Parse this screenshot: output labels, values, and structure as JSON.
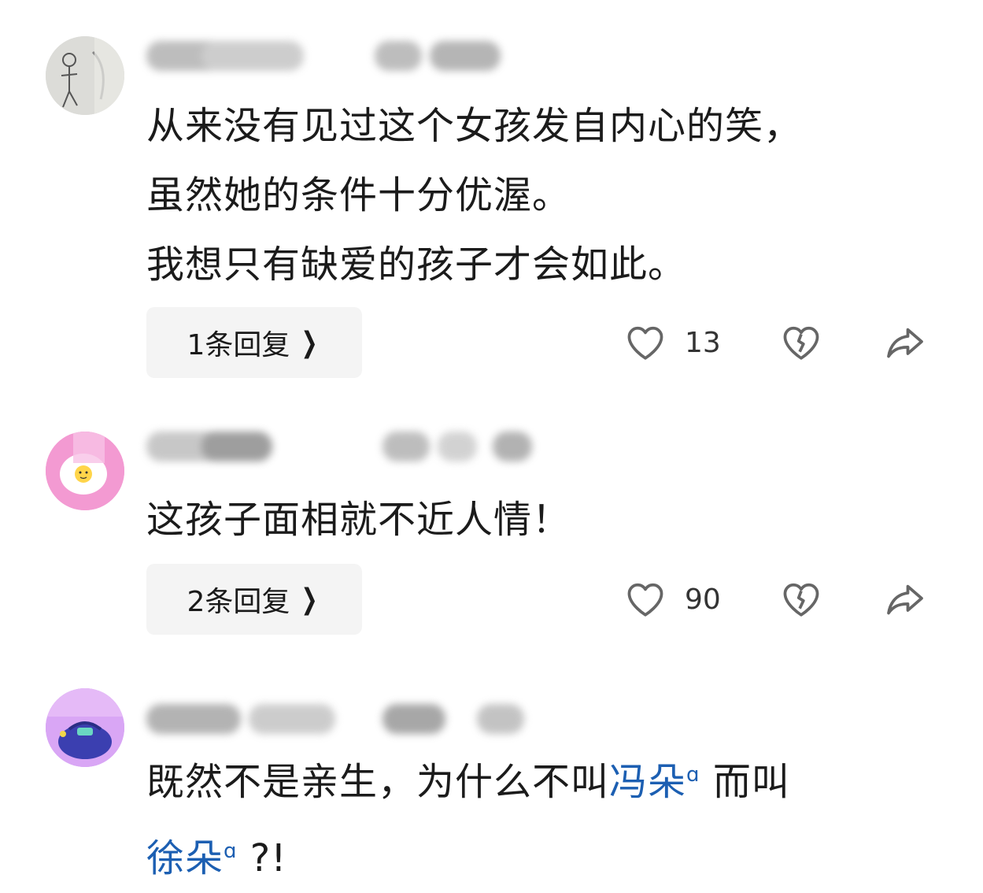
{
  "comments": [
    {
      "avatar": "avatar-sketch",
      "username_obscured": "pen-scribble",
      "text_lines": [
        "从来没有见过这个女孩发自内心的笑，",
        "虽然她的条件十分优渥。",
        "我想只有缺爱的孩子才会如此。"
      ],
      "reply_label": "1条回复",
      "like_count": "13"
    },
    {
      "avatar": "avatar-egg",
      "username_obscured": "pen-scribble",
      "text_lines": [
        "这孩子面相就不近人情！"
      ],
      "reply_label": "2条回复",
      "like_count": "90"
    },
    {
      "avatar": "avatar-purple",
      "username_obscured": "pen-scribble",
      "text_line_1_before": "既然不是亲生，为什么不叫",
      "link_1": "冯朵",
      "text_line_1_after": "而叫",
      "link_2": "徐朵",
      "text_line_2_after": "?!"
    }
  ],
  "colors": {
    "link": "#1c5fb2",
    "reply_bg": "#f4f4f4",
    "icon": "#666666"
  },
  "icons": {
    "like": "heart-icon",
    "dislike": "broken-heart-icon",
    "share": "share-arrow-icon",
    "chevron": "chevron-right-icon",
    "search_hint": "search-hint-icon"
  }
}
